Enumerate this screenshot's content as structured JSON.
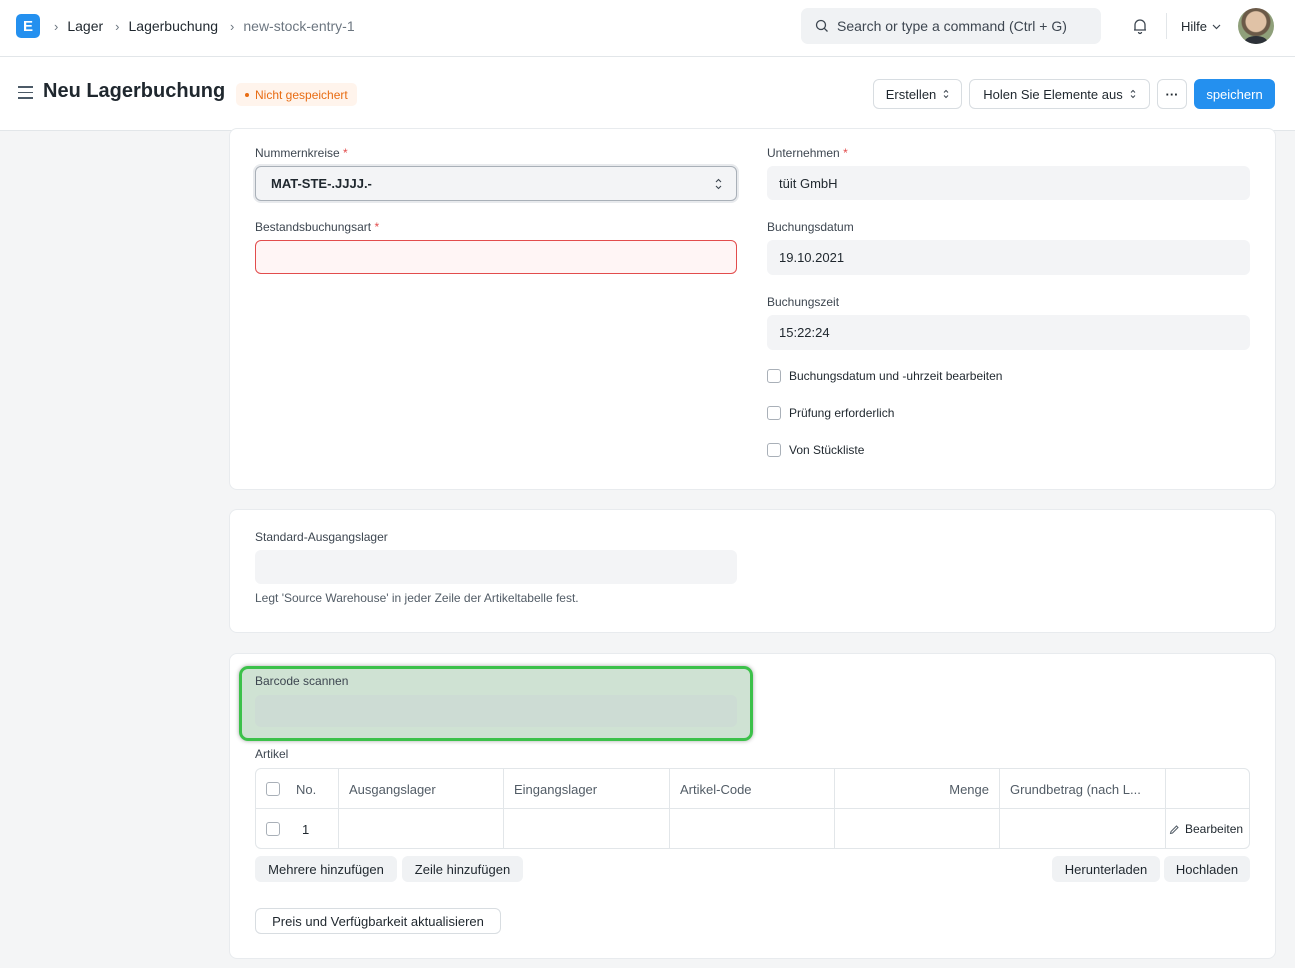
{
  "navbar": {
    "logo_letter": "E",
    "breadcrumbs": [
      "Lager",
      "Lagerbuchung",
      "new-stock-entry-1"
    ],
    "search_placeholder": "Search or type a command (Ctrl + G)",
    "help_label": "Hilfe"
  },
  "page": {
    "title": "Neu Lagerbuchung",
    "status_badge": "Nicht gespeichert",
    "actions": {
      "create_label": "Erstellen",
      "get_items_label": "Holen Sie Elemente aus",
      "more_label": "···",
      "save_label": "speichern"
    }
  },
  "form": {
    "naming_series": {
      "label": "Nummernkreise",
      "required": "*",
      "value": "MAT-STE-.JJJJ.-"
    },
    "company": {
      "label": "Unternehmen",
      "required": "*",
      "value": "tüit GmbH"
    },
    "entry_type": {
      "label": "Bestandsbuchungsart",
      "required": "*",
      "value": ""
    },
    "posting_date": {
      "label": "Buchungsdatum",
      "value": "19.10.2021"
    },
    "posting_time": {
      "label": "Buchungszeit",
      "value": "15:22:24"
    },
    "checkboxes": [
      "Buchungsdatum und -uhrzeit bearbeiten",
      "Prüfung erforderlich",
      "Von Stückliste"
    ],
    "source_warehouse": {
      "label": "Standard-Ausgangslager",
      "value": "",
      "description": "Legt 'Source Warehouse' in jeder Zeile der Artikeltabelle fest."
    },
    "barcode": {
      "label": "Barcode scannen",
      "value": ""
    },
    "items": {
      "label": "Artikel",
      "columns": [
        "No.",
        "Ausgangslager",
        "Eingangslager",
        "Artikel-Code",
        "Menge",
        "Grundbetrag (nach L..."
      ],
      "rows": [
        {
          "no": "1",
          "edit_label": "Bearbeiten"
        }
      ],
      "buttons": {
        "add_multiple": "Mehrere hinzufügen",
        "add_row": "Zeile hinzufügen",
        "download": "Herunterladen",
        "upload": "Hochladen"
      }
    },
    "update_rate_button": "Preis und Verfügbarkeit aktualisieren"
  },
  "colors": {
    "primary": "#2490ef",
    "required": "#e24c4c",
    "badge_text": "#e86c13",
    "highlight_border": "#3cc14a"
  }
}
